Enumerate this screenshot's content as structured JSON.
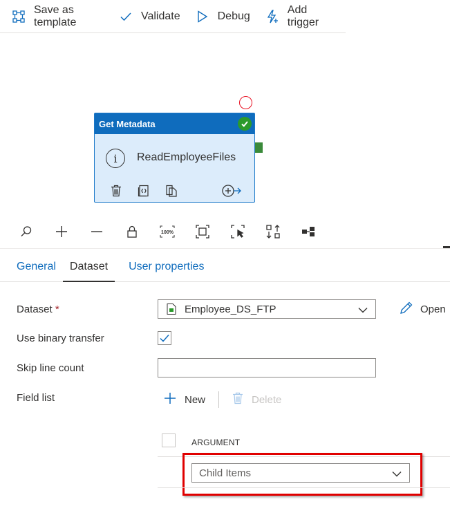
{
  "toolbar": {
    "save_template": "Save as template",
    "validate": "Validate",
    "debug": "Debug",
    "add_trigger": "Add trigger"
  },
  "activity": {
    "type": "Get Metadata",
    "name": "ReadEmployeeFiles",
    "info_glyph": "i"
  },
  "zoom_toolbar": {
    "fit_label": "100%"
  },
  "tabs": [
    {
      "label": "General"
    },
    {
      "label": "Dataset"
    },
    {
      "label": "User properties"
    }
  ],
  "form": {
    "dataset_label": "Dataset",
    "required_mark": "*",
    "dataset_value": "Employee_DS_FTP",
    "open_label": "Open",
    "binary_label": "Use binary transfer",
    "skip_label": "Skip line count",
    "skip_value": "",
    "field_list_label": "Field list",
    "new_label": "New",
    "delete_label": "Delete",
    "argument_header": "ARGUMENT",
    "argument_value": "Child Items"
  },
  "colors": {
    "accent": "#0f6cbd",
    "success": "#2b9a2b",
    "error": "#e81123",
    "highlight": "#e00000"
  }
}
